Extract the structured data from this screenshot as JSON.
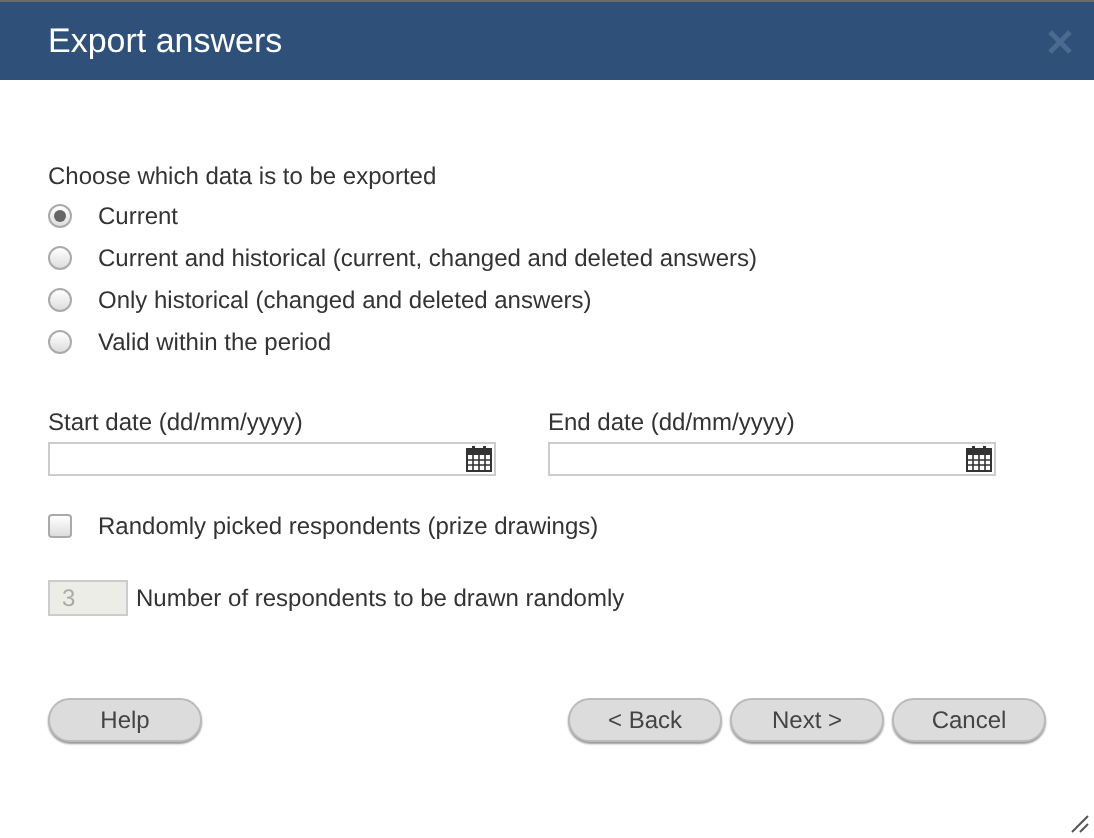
{
  "window": {
    "title": "Export answers"
  },
  "prompt": "Choose which data is to be exported",
  "options": [
    {
      "label": "Current",
      "selected": true
    },
    {
      "label": "Current and historical (current, changed and deleted answers)",
      "selected": false
    },
    {
      "label": "Only historical (changed and deleted answers)",
      "selected": false
    },
    {
      "label": "Valid within the period",
      "selected": false
    }
  ],
  "dates": [
    {
      "label": "Start date (dd/mm/yyyy)"
    },
    {
      "label": "End date (dd/mm/yyyy)"
    }
  ],
  "random": {
    "label": "Randomly picked respondents (prize drawings)",
    "checked": false
  },
  "count": {
    "value": "3",
    "disabled": true,
    "label": "Number of respondents to be drawn randomly"
  },
  "buttons": {
    "left": [
      "Help"
    ],
    "right": [
      "< Back",
      "Next >",
      "Cancel"
    ]
  }
}
